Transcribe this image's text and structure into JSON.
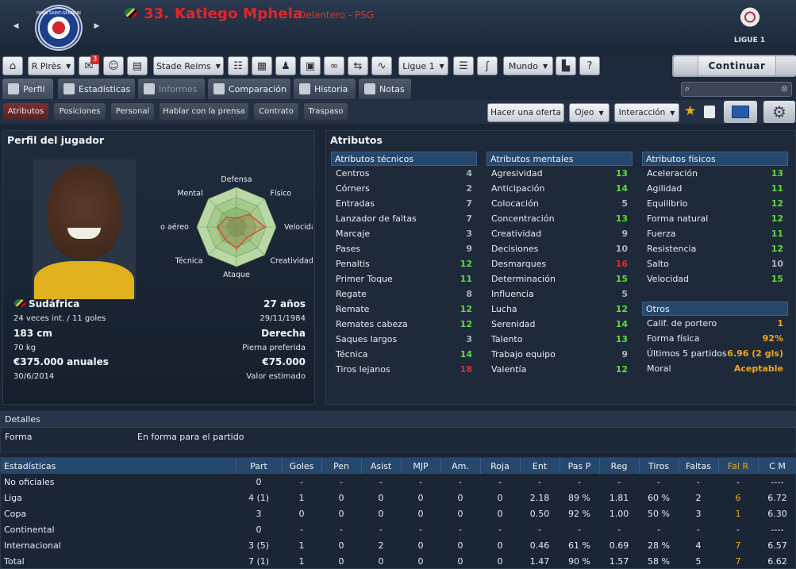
{
  "header": {
    "crest_text": "PARIS SAINT-GERMAIN",
    "player_title": "33. Katlego Mphela",
    "player_role": "Delantero - PSG",
    "league_logo_text": "LIGUE 1"
  },
  "toolbar": {
    "manager": "R Pirès",
    "inbox_badge": "3",
    "team": "Stade Reims",
    "league": "Ligue 1",
    "world": "Mundo",
    "help": "?",
    "continue": "Continuar"
  },
  "tabs": [
    {
      "label": "Perfil"
    },
    {
      "label": "Estadísticas"
    },
    {
      "label": "Informes"
    },
    {
      "label": "Comparación"
    },
    {
      "label": "Historia"
    },
    {
      "label": "Notas"
    }
  ],
  "subtabs": [
    {
      "label": "Atributos"
    },
    {
      "label": "Posiciones"
    },
    {
      "label": "Personal"
    },
    {
      "label": "Hablar con la prensa"
    },
    {
      "label": "Contrato"
    },
    {
      "label": "Traspaso"
    }
  ],
  "actions": {
    "offer": "Hacer una oferta",
    "scout": "Ojeo",
    "interaction": "Interacción"
  },
  "profile": {
    "title": "Perfil del jugador",
    "nationality": "Sudáfrica",
    "age": "27 años",
    "caps": "24 veces int. / 11 goles",
    "birthdate": "29/11/1984",
    "height": "183 cm",
    "foot": "Derecha",
    "weight": "70 kg",
    "foot_label": "Pierna preferida",
    "wage": "€375.000 anuales",
    "value": "€75.000",
    "contract_end": "30/6/2014",
    "value_label": "Valor estimado"
  },
  "radar": {
    "labels": [
      "Defensa",
      "Físico",
      "Velocida",
      "Creatividad",
      "Ataque",
      "Técnica",
      "Juego aéreo",
      "Mental"
    ],
    "values": [
      0.22,
      0.45,
      0.72,
      0.38,
      0.55,
      0.42,
      0.48,
      0.35
    ]
  },
  "attributes": {
    "title": "Atributos",
    "technical": {
      "header": "Atributos técnicos",
      "rows": [
        {
          "name": "Centros",
          "value": "4",
          "color": "grey"
        },
        {
          "name": "Córners",
          "value": "2",
          "color": "grey"
        },
        {
          "name": "Entradas",
          "value": "7",
          "color": "grey"
        },
        {
          "name": "Lanzador de faltas",
          "value": "7",
          "color": "grey"
        },
        {
          "name": "Marcaje",
          "value": "3",
          "color": "grey"
        },
        {
          "name": "Pases",
          "value": "9",
          "color": "grey"
        },
        {
          "name": "Penaltis",
          "value": "12",
          "color": "green"
        },
        {
          "name": "Primer Toque",
          "value": "11",
          "color": "green"
        },
        {
          "name": "Regate",
          "value": "8",
          "color": "grey"
        },
        {
          "name": "Remate",
          "value": "12",
          "color": "green"
        },
        {
          "name": "Remates cabeza",
          "value": "12",
          "color": "green"
        },
        {
          "name": "Saques largos",
          "value": "3",
          "color": "grey"
        },
        {
          "name": "Técnica",
          "value": "14",
          "color": "green"
        },
        {
          "name": "Tiros lejanos",
          "value": "18",
          "color": "red"
        }
      ]
    },
    "mental": {
      "header": "Atributos mentales",
      "rows": [
        {
          "name": "Agresividad",
          "value": "13",
          "color": "green"
        },
        {
          "name": "Anticipación",
          "value": "14",
          "color": "green"
        },
        {
          "name": "Colocación",
          "value": "5",
          "color": "grey"
        },
        {
          "name": "Concentración",
          "value": "13",
          "color": "green"
        },
        {
          "name": "Creatividad",
          "value": "9",
          "color": "grey"
        },
        {
          "name": "Decisiones",
          "value": "10",
          "color": "grey"
        },
        {
          "name": "Desmarques",
          "value": "16",
          "color": "red"
        },
        {
          "name": "Determinación",
          "value": "15",
          "color": "green"
        },
        {
          "name": "Influencia",
          "value": "5",
          "color": "grey"
        },
        {
          "name": "Lucha",
          "value": "12",
          "color": "green"
        },
        {
          "name": "Serenidad",
          "value": "14",
          "color": "green"
        },
        {
          "name": "Talento",
          "value": "13",
          "color": "green"
        },
        {
          "name": "Trabajo equipo",
          "value": "9",
          "color": "grey"
        },
        {
          "name": "Valentía",
          "value": "12",
          "color": "green"
        }
      ]
    },
    "physical": {
      "header": "Atributos físicos",
      "rows": [
        {
          "name": "Aceleración",
          "value": "13",
          "color": "green"
        },
        {
          "name": "Agilidad",
          "value": "11",
          "color": "green"
        },
        {
          "name": "Equilibrio",
          "value": "12",
          "color": "green"
        },
        {
          "name": "Forma natural",
          "value": "12",
          "color": "green"
        },
        {
          "name": "Fuerza",
          "value": "11",
          "color": "green"
        },
        {
          "name": "Resistencia",
          "value": "12",
          "color": "green"
        },
        {
          "name": "Salto",
          "value": "10",
          "color": "grey"
        },
        {
          "name": "Velocidad",
          "value": "15",
          "color": "green"
        }
      ]
    },
    "other": {
      "header": "Otros",
      "rows": [
        {
          "name": "Calif. de portero",
          "value": "1",
          "color": "orange"
        },
        {
          "name": "Forma física",
          "value": "92%",
          "color": "orange"
        },
        {
          "name": "Últimos 5 partidos",
          "value": "6.96 (2 gls)",
          "color": "orange"
        },
        {
          "name": "Moral",
          "value": "Aceptable",
          "color": "orange"
        }
      ]
    }
  },
  "details": {
    "header": "Detalles",
    "forma_label": "Forma",
    "forma_value": "En forma para el partido"
  },
  "stats": {
    "headers": [
      "Estadísticas",
      "Part",
      "Goles",
      "Pen",
      "Asist",
      "MJP",
      "Am.",
      "Roja",
      "Ent",
      "Pas P",
      "Reg",
      "Tiros",
      "Faltas",
      "Fal R",
      "C M"
    ],
    "rows": [
      [
        "No oficiales",
        "0",
        "-",
        "-",
        "-",
        "-",
        "-",
        "-",
        "-",
        "-",
        "-",
        "-",
        "-",
        "-",
        "----"
      ],
      [
        "Liga",
        "4 (1)",
        "1",
        "0",
        "0",
        "0",
        "0",
        "0",
        "2.18",
        "89 %",
        "1.81",
        "60 %",
        "2",
        "6",
        "6.72"
      ],
      [
        "Copa",
        "3",
        "0",
        "0",
        "0",
        "0",
        "0",
        "0",
        "0.50",
        "92 %",
        "1.00",
        "50 %",
        "3",
        "1",
        "6.30"
      ],
      [
        "Continental",
        "0",
        "-",
        "-",
        "-",
        "-",
        "-",
        "-",
        "-",
        "-",
        "-",
        "-",
        "-",
        "-",
        "----"
      ],
      [
        "Internacional",
        "3 (5)",
        "1",
        "0",
        "2",
        "0",
        "0",
        "0",
        "0.46",
        "61 %",
        "0.69",
        "28 %",
        "4",
        "7",
        "6.57"
      ],
      [
        "Total",
        "7 (1)",
        "1",
        "0",
        "0",
        "0",
        "0",
        "0",
        "1.47",
        "90 %",
        "1.57",
        "58 %",
        "5",
        "7",
        "6.62"
      ]
    ]
  }
}
